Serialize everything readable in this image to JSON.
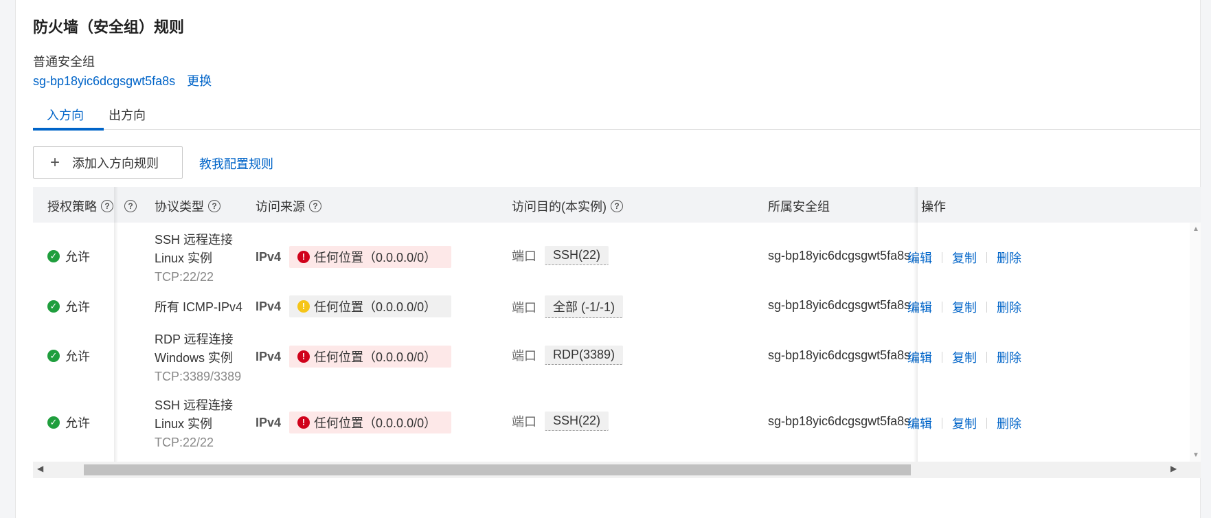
{
  "section_title": "防火墙（安全组）规则",
  "sg_type": "普通安全组",
  "sg_id": "sg-bp18yic6dcgsgwt5fa8s",
  "change_label": "更换",
  "tabs": [
    {
      "label": "入方向",
      "active": true
    },
    {
      "label": "出方向",
      "active": false
    }
  ],
  "add_rule_label": "添加入方向规则",
  "teach_label": "教我配置规则",
  "columns": {
    "policy": "授权策略",
    "protocol": "协议类型",
    "source": "访问来源",
    "destination": "访问目的(本实例)",
    "group": "所属安全组",
    "actions": "操作"
  },
  "rows": [
    {
      "policy": "允许",
      "proto_name": "SSH 远程连接",
      "proto_os": "Linux 实例",
      "proto_port": "TCP:22/22",
      "ip": "IPv4",
      "source": "任何位置（0.0.0.0/0）",
      "level": "danger",
      "dst_label": "端口",
      "port": "SSH(22)",
      "group": "sg-bp18yic6dcgsgwt5fa8s"
    },
    {
      "policy": "允许",
      "proto_name": "所有 ICMP-IPv4",
      "proto_os": "",
      "proto_port": "",
      "ip": "IPv4",
      "source": "任何位置（0.0.0.0/0）",
      "level": "warn",
      "dst_label": "端口",
      "port": "全部 (-1/-1)",
      "group": "sg-bp18yic6dcgsgwt5fa8s"
    },
    {
      "policy": "允许",
      "proto_name": "RDP 远程连接",
      "proto_os": "Windows 实例",
      "proto_port": "TCP:3389/3389",
      "ip": "IPv4",
      "source": "任何位置（0.0.0.0/0）",
      "level": "danger",
      "dst_label": "端口",
      "port": "RDP(3389)",
      "group": "sg-bp18yic6dcgsgwt5fa8s"
    },
    {
      "policy": "允许",
      "proto_name": "SSH 远程连接",
      "proto_os": "Linux 实例",
      "proto_port": "TCP:22/22",
      "ip": "IPv4",
      "source": "任何位置（0.0.0.0/0）",
      "level": "danger",
      "dst_label": "端口",
      "port": "SSH(22)",
      "group": "sg-bp18yic6dcgsgwt5fa8s"
    }
  ],
  "actions": {
    "edit": "编辑",
    "copy": "复制",
    "delete": "删除"
  },
  "colors": {
    "link": "#0064c8",
    "danger": "#d0021b",
    "warning": "#f5c518",
    "success": "#1f9e3d"
  }
}
